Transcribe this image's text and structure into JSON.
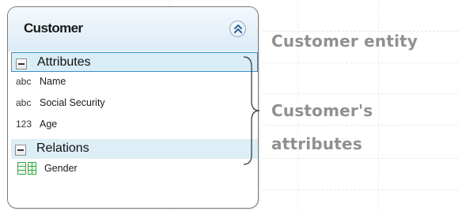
{
  "entity": {
    "title": "Customer",
    "collapse_icon": "double-chevron-up-icon",
    "attributes": {
      "label": "Attributes",
      "toggle_icon": "minus-box-icon",
      "items": [
        {
          "type": "abc",
          "name": "Name"
        },
        {
          "type": "abc",
          "name": "Social Security"
        },
        {
          "type": "123",
          "name": "Age"
        }
      ]
    },
    "relations": {
      "label": "Relations",
      "toggle_icon": "minus-box-icon",
      "items": [
        {
          "icon": "relation-table-icon",
          "name": "Gender"
        }
      ]
    }
  },
  "annotations": {
    "entity_label": "Customer entity",
    "attributes_label_line1": "Customer's",
    "attributes_label_line2": "attributes"
  },
  "colors": {
    "header_gradient_top": "#f4f9fd",
    "header_gradient_bottom": "#dcebf6",
    "section_bg": "#ddeef6",
    "selected_border": "#3c90c9",
    "annotation_text": "#909090",
    "relation_icon_green": "#3aa84a"
  }
}
